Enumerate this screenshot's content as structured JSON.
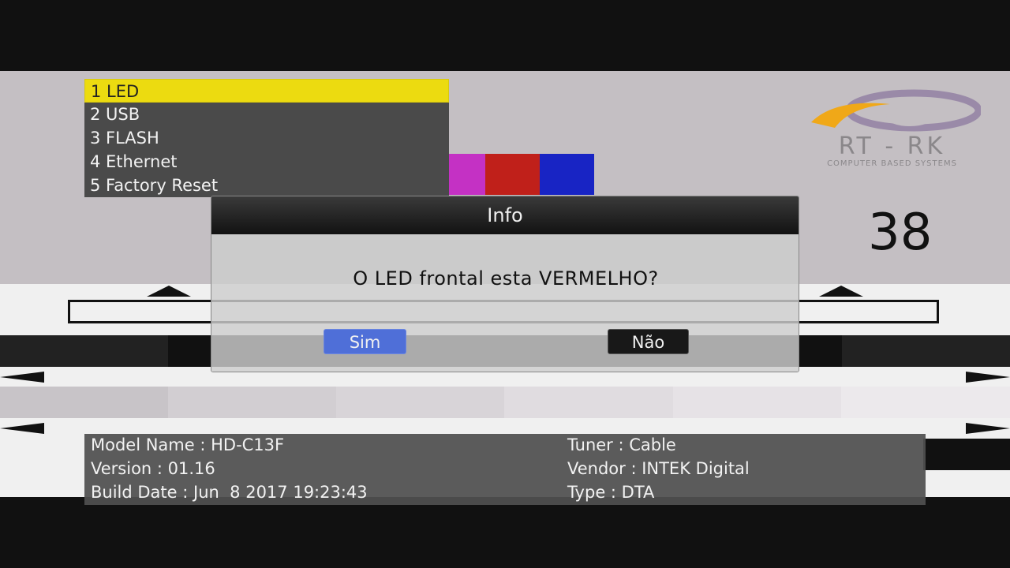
{
  "menu": {
    "items": [
      {
        "label": "1 LED"
      },
      {
        "label": "2 USB"
      },
      {
        "label": "3 FLASH"
      },
      {
        "label": "4 Ethernet"
      },
      {
        "label": "5 Factory Reset"
      }
    ],
    "selected_index": 0
  },
  "logo": {
    "text": "RT - RK",
    "subtitle": "COMPUTER BASED SYSTEMS"
  },
  "channel_number": "38",
  "dialog": {
    "title": "Info",
    "message": "O LED frontal esta VERMELHO?",
    "yes_label": "Sim",
    "no_label": "Não"
  },
  "device_info": {
    "model_name": "Model Name : HD-C13F",
    "version": "Version : 01.16",
    "build_date": "Build Date : Jun  8 2017 19:23:43",
    "tuner": "Tuner : Cable",
    "vendor": "Vendor : INTEK Digital",
    "type": "Type : DTA"
  },
  "colors": {
    "menu_highlight": "#ecdb10",
    "yes_button": "#4f6fd8",
    "bar_magenta": "#c431c4",
    "bar_red": "#c0201a",
    "bar_blue": "#1824c4",
    "logo_orange": "#f0a818",
    "logo_purple": "#9a8aa8"
  }
}
